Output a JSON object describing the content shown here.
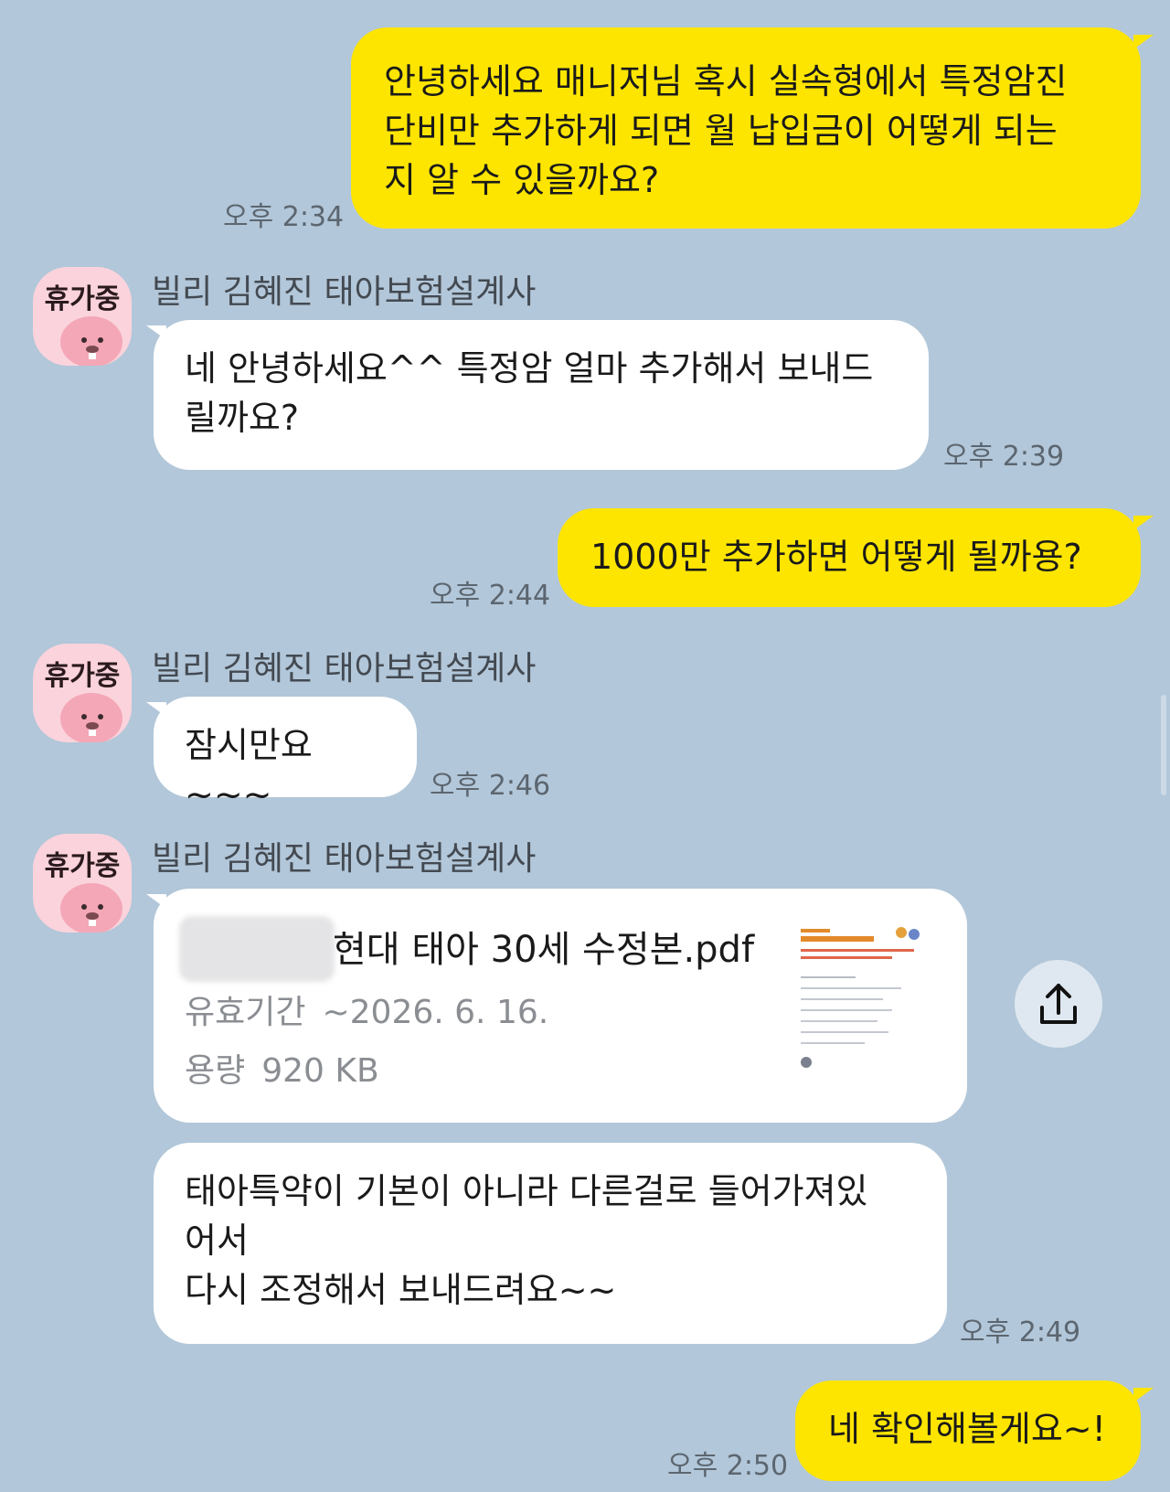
{
  "messages": {
    "m1": {
      "text": "안녕하세요 매니저님 혹시 실속형에서 특정암진\n단비만 추가하게 되면 월 납입금이 어떻게 되는\n지 알 수 있을까요?",
      "time": "오후 2:34"
    },
    "m2": {
      "sender": "빌리 김혜진 태아보험설계사",
      "avatar_status": "휴가중",
      "text": "네 안녕하세요^^ 특정암 얼마 추가해서 보내드\n릴까요?",
      "time": "오후 2:39"
    },
    "m3": {
      "text": "1000만 추가하면 어떻게 될까용?",
      "time": "오후 2:44"
    },
    "m4": {
      "sender": "빌리 김혜진 태아보험설계사",
      "avatar_status": "휴가중",
      "text": "잠시만요~~~",
      "time": "오후 2:46"
    },
    "m5": {
      "sender": "빌리 김혜진 태아보험설계사",
      "avatar_status": "휴가중",
      "file": {
        "name": "현대 태아 30세 수정본.pdf",
        "expiry_label": "유효기간",
        "expiry_value": "~2026. 6. 16.",
        "size_label": "용량",
        "size_value": "920 KB"
      },
      "text": "태아특약이 기본이 아니라 다른걸로 들어가져있\n어서\n다시 조정해서 보내드려요~~",
      "time": "오후 2:49"
    },
    "m6": {
      "text": "네 확인해볼게요~!",
      "time": "오후 2:50"
    }
  },
  "colors": {
    "background": "#b2c7d9",
    "my_bubble": "#fee500",
    "their_bubble": "#ffffff"
  },
  "icons": {
    "avatar": "pink-beaver-character-icon",
    "share": "share-upload-icon",
    "thumbnail": "pdf-thumbnail-icon"
  }
}
